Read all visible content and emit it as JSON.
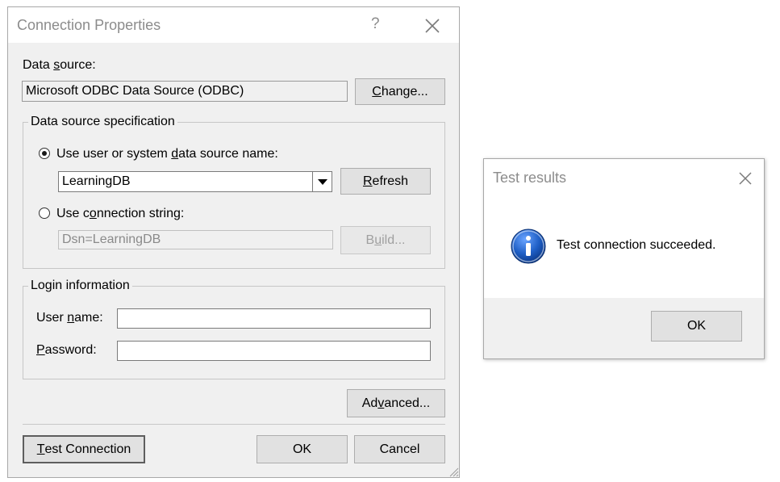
{
  "connection_dialog": {
    "title": "Connection Properties",
    "help_glyph": "?",
    "data_source_label_pre": "Data ",
    "data_source_label_ul": "s",
    "data_source_label_post": "ource:",
    "data_source_value": "Microsoft ODBC Data Source (ODBC)",
    "change_btn_ul": "C",
    "change_btn_post": "hange...",
    "spec_group": {
      "legend": "Data source specification",
      "dsn_radio_pre": "Use user or system ",
      "dsn_radio_ul": "d",
      "dsn_radio_post": "ata source name:",
      "dsn_selected": "LearningDB",
      "refresh_btn_ul": "R",
      "refresh_btn_post": "efresh",
      "connstr_radio_pre": "Use c",
      "connstr_radio_ul": "o",
      "connstr_radio_post": "nnection string:",
      "connstr_value": "Dsn=LearningDB",
      "build_btn_pre": "B",
      "build_btn_ul": "u",
      "build_btn_post": "ild..."
    },
    "login_group": {
      "legend": "Login information",
      "username_pre": "User ",
      "username_ul": "n",
      "username_post": "ame:",
      "username_value": "",
      "password_ul": "P",
      "password_post": "assword:",
      "password_value": ""
    },
    "advanced_pre": "Ad",
    "advanced_ul": "v",
    "advanced_post": "anced...",
    "test_ul": "T",
    "test_post": "est Connection",
    "ok": "OK",
    "cancel": "Cancel"
  },
  "test_results_dialog": {
    "title": "Test results",
    "message": "Test connection succeeded.",
    "ok": "OK",
    "icon": "information-icon"
  },
  "colors": {
    "dialog_bg": "#f0f0f0",
    "button_bg": "#e1e1e1",
    "info_icon_blue": "#1f5fc6"
  }
}
